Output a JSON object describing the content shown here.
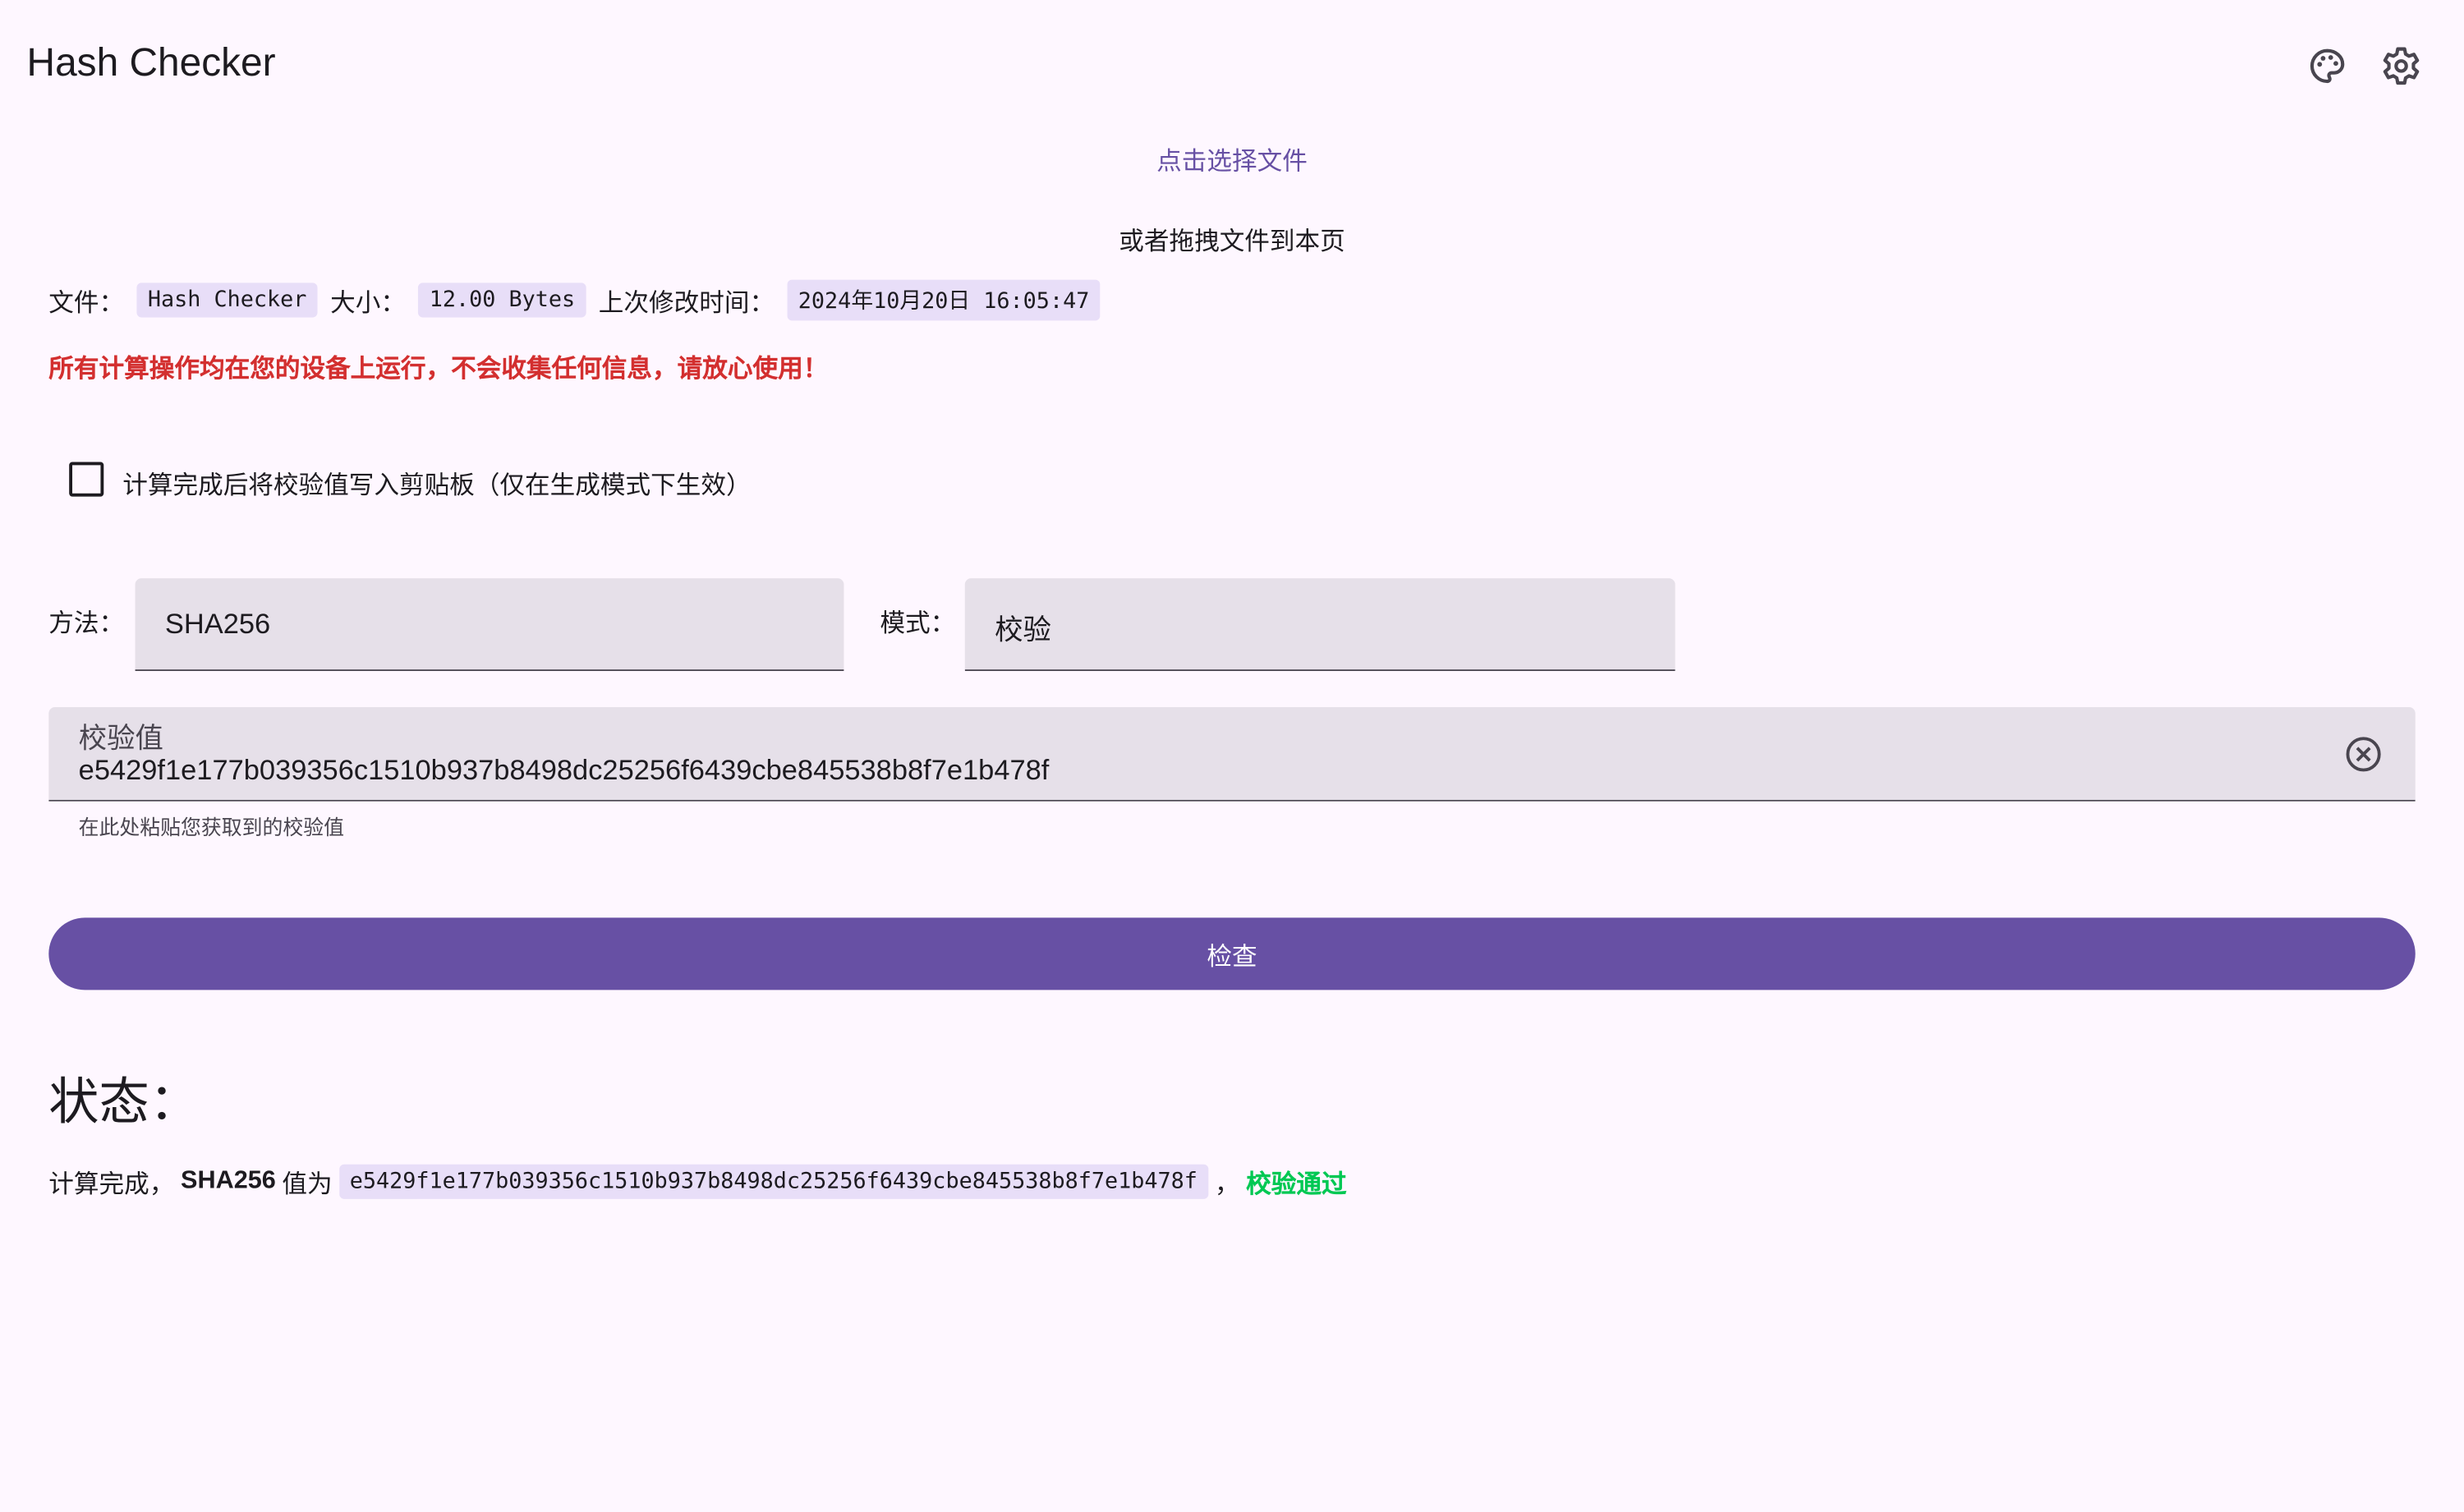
{
  "app": {
    "title": "Hash Checker",
    "icons": [
      "palette-icon",
      "gear-icon"
    ]
  },
  "picker": {
    "click_label": "点击选择文件",
    "drag_label": "或者拖拽文件到本页"
  },
  "file_info": {
    "file_label": "文件：",
    "file_name": "Hash Checker",
    "size_label": "大小：",
    "size": "12.00 Bytes",
    "modified_label": "上次修改时间：",
    "modified": "2024年10月20日 16:05:47"
  },
  "warning": "所有计算操作均在您的设备上运行，不会收集任何信息，请放心使用！",
  "clipboard_option": {
    "label": "计算完成后将校验值写入剪贴板（仅在生成模式下生效）",
    "checked": false
  },
  "method": {
    "label": "方法：",
    "value": "SHA256"
  },
  "mode": {
    "label": "模式：",
    "value": "校验"
  },
  "hash_input": {
    "label": "校验值",
    "value": "e5429f1e177b039356c1510b937b8498dc25256f6439cbe845538b8f7e1b478f",
    "helper": "在此处粘贴您获取到的校验值"
  },
  "check_button": "检查",
  "status": {
    "heading": "状态：",
    "prefix": "计算完成，",
    "algo": "SHA256",
    "middle": " 值为",
    "hash": "e5429f1e177b039356c1510b937b8498dc25256f6439cbe845538b8f7e1b478f",
    "comma": "，",
    "result": "校验通过"
  },
  "colors": {
    "primary": "#6750a4",
    "warning": "#d32f2f",
    "success": "#00c853",
    "chip": "#e8def8",
    "field": "#e6e0e9",
    "background": "#fef7ff"
  }
}
